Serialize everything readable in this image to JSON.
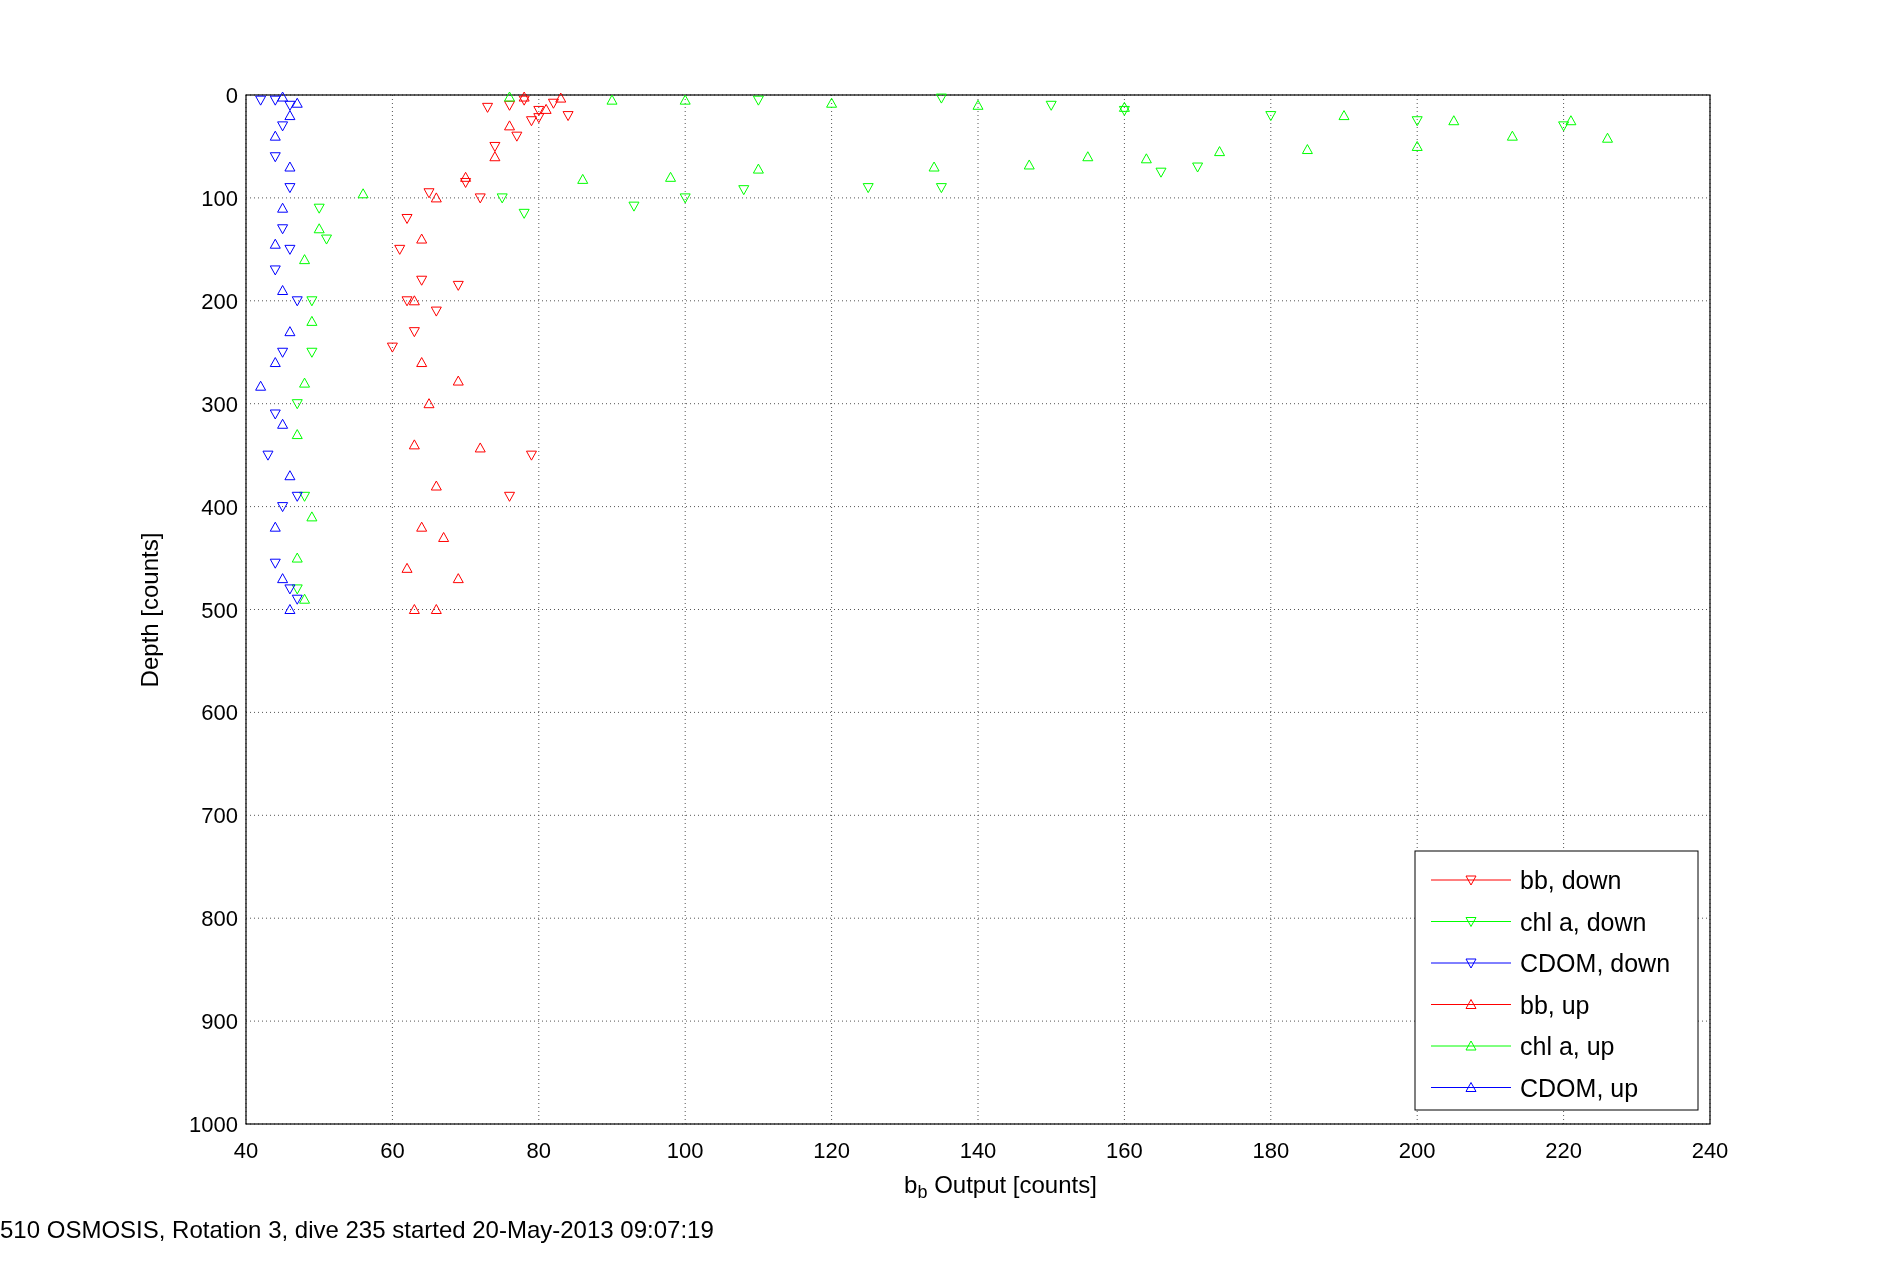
{
  "figure": {
    "chart_data": {
      "type": "scatter",
      "grid": true,
      "legend": true,
      "xlabel": "b$_{b}$ Output [counts]",
      "ylabel": "Depth [counts]",
      "xlim": [
        40,
        240
      ],
      "ylim": [
        1000,
        0
      ],
      "xticks": [
        40,
        60,
        80,
        100,
        120,
        140,
        160,
        180,
        200,
        220,
        240
      ],
      "yticks": [
        0,
        100,
        200,
        300,
        400,
        500,
        600,
        700,
        800,
        900,
        1000
      ],
      "series": [
        {
          "name": "bb, down",
          "color": "#ff0000",
          "marker": "triangle-down",
          "x": [
            76,
            78,
            80,
            82,
            84,
            79,
            74,
            77,
            72,
            70,
            65,
            62,
            61,
            62,
            60,
            64,
            66,
            69,
            79,
            76,
            63,
            80,
            73
          ],
          "values": [
            10,
            5,
            15,
            8,
            20,
            25,
            50,
            40,
            100,
            85,
            95,
            120,
            150,
            200,
            245,
            180,
            210,
            185,
            350,
            390,
            230,
            22,
            12
          ]
        },
        {
          "name": "chl a, down",
          "color": "#00ff00",
          "marker": "triangle-down",
          "x": [
            110,
            135,
            150,
            180,
            200,
            220,
            160,
            125,
            135,
            100,
            108,
            93,
            75,
            78,
            50,
            49,
            47,
            48,
            47,
            51,
            49,
            170,
            165
          ],
          "values": [
            5,
            3,
            10,
            20,
            25,
            30,
            15,
            90,
            90,
            100,
            92,
            108,
            100,
            115,
            110,
            200,
            300,
            390,
            480,
            140,
            250,
            70,
            75
          ]
        },
        {
          "name": "CDOM, down",
          "color": "#0000ff",
          "marker": "triangle-down",
          "x": [
            44,
            46,
            45,
            44,
            46,
            45,
            44,
            47,
            45,
            44,
            43,
            45,
            44,
            46,
            47,
            42,
            46,
            47
          ],
          "values": [
            5,
            10,
            30,
            60,
            90,
            130,
            170,
            200,
            250,
            310,
            350,
            400,
            455,
            480,
            490,
            5,
            150,
            390
          ]
        },
        {
          "name": "bb, up",
          "color": "#ff0000",
          "marker": "triangle-up",
          "x": [
            78,
            81,
            83,
            76,
            74,
            70,
            66,
            64,
            63,
            64,
            65,
            63,
            66,
            64,
            62,
            63,
            66,
            69,
            67,
            69,
            72
          ],
          "values": [
            2,
            14,
            3,
            30,
            60,
            80,
            100,
            140,
            200,
            260,
            300,
            340,
            380,
            420,
            460,
            500,
            500,
            278,
            430,
            470,
            343
          ]
        },
        {
          "name": "chl a, up",
          "color": "#00ff00",
          "marker": "triangle-up",
          "x": [
            76,
            90,
            100,
            120,
            140,
            160,
            190,
            205,
            221,
            226,
            213,
            200,
            185,
            173,
            163,
            155,
            147,
            134,
            110,
            98,
            86,
            56,
            50,
            48,
            49,
            48,
            47,
            49,
            47,
            48
          ],
          "values": [
            2,
            5,
            5,
            8,
            10,
            12,
            20,
            25,
            25,
            42,
            40,
            50,
            53,
            55,
            62,
            60,
            68,
            70,
            72,
            80,
            82,
            96,
            130,
            160,
            220,
            280,
            330,
            410,
            450,
            490
          ]
        },
        {
          "name": "CDOM, up",
          "color": "#0000ff",
          "marker": "triangle-up",
          "x": [
            45,
            47,
            46,
            44,
            46,
            45,
            44,
            45,
            46,
            44,
            42,
            45,
            46,
            44,
            45,
            46
          ],
          "values": [
            2,
            8,
            20,
            40,
            70,
            110,
            145,
            190,
            230,
            260,
            283,
            320,
            370,
            420,
            470,
            500
          ]
        }
      ]
    },
    "caption": "510 OSMOSIS, Rotation 3, dive 235 started 20-May-2013 09:07:19"
  }
}
